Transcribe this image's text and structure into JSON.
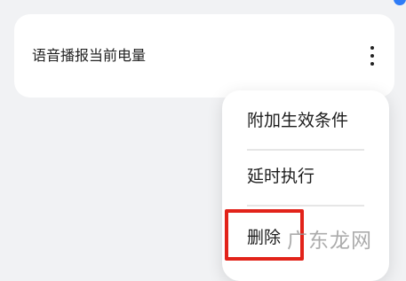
{
  "card": {
    "title": "语音播报当前电量",
    "more_icon": "more-vertical-icon"
  },
  "menu": {
    "items": [
      {
        "label": "附加生效条件"
      },
      {
        "label": "延时执行"
      },
      {
        "label": "删除"
      }
    ]
  },
  "overlay": {
    "highlight_color": "#e2231a",
    "watermark": "广东龙网"
  },
  "colors": {
    "background": "#f1f2f4",
    "card": "#ffffff",
    "accent_dot": "#2f7cf6"
  }
}
